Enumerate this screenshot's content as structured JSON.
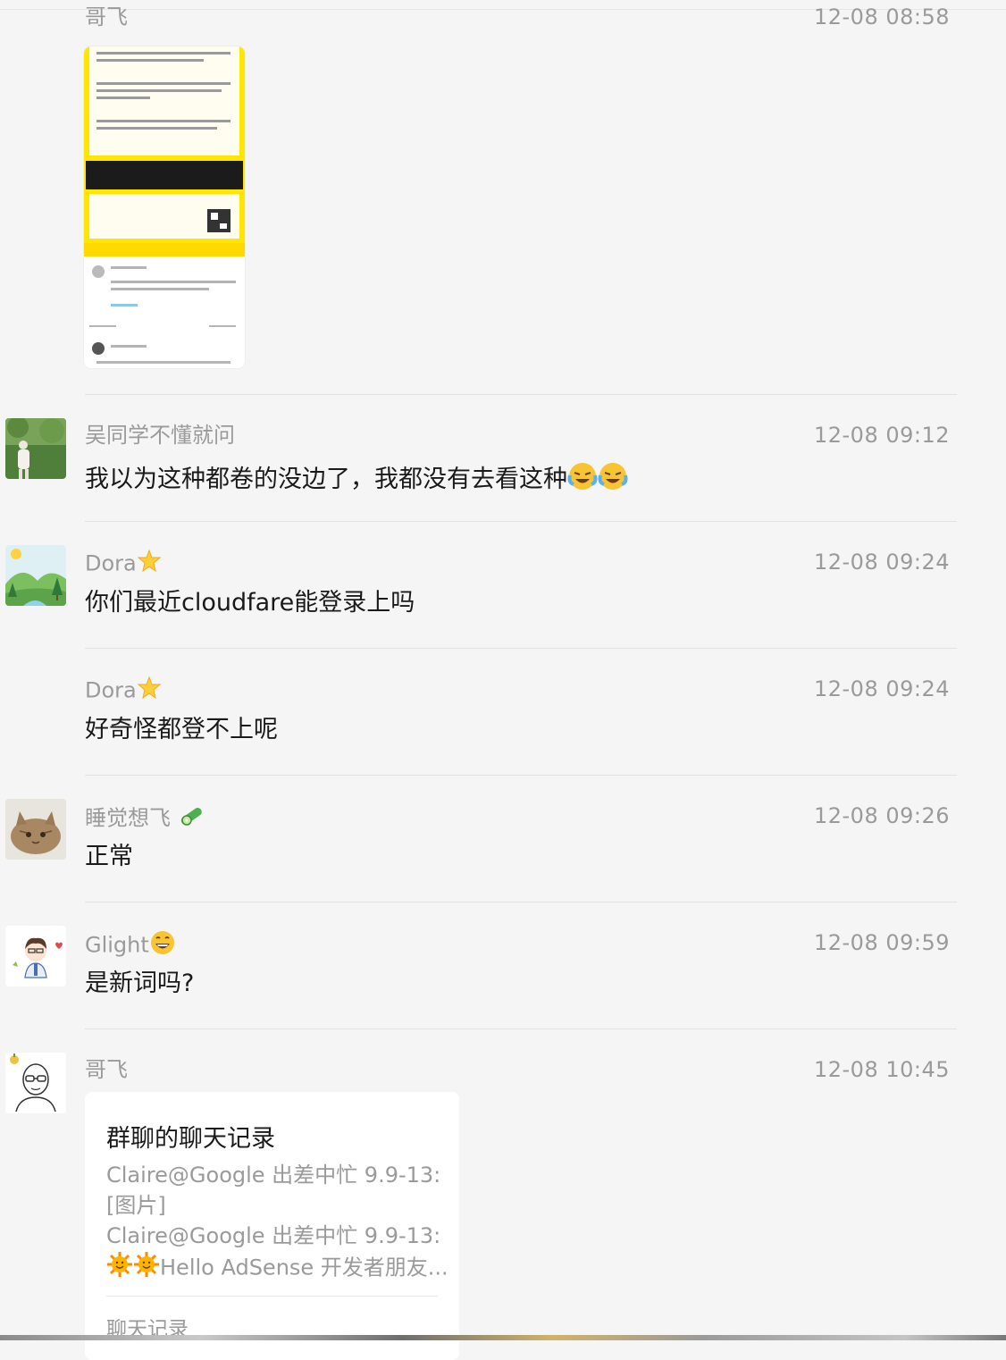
{
  "messages": [
    {
      "sender": "哥飞",
      "time": "12-08 08:58",
      "attachment": "image"
    },
    {
      "sender": "吴同学不懂就问",
      "time": "12-08 09:12",
      "text": "我以为这种都卷的没边了，我都没有去看这种",
      "emojis": [
        "laugh-cry-emoji",
        "laugh-cry-emoji"
      ]
    },
    {
      "sender": "Dora",
      "sender_emoji": "glowing-star-emoji",
      "time": "12-08 09:24",
      "text": "你们最近cloudfare能登录上吗"
    },
    {
      "sender": "Dora",
      "sender_emoji": "glowing-star-emoji",
      "time": "12-08 09:24",
      "text": "好奇怪都登不上呢"
    },
    {
      "sender": "睡觉想飞",
      "sender_emoji": "cucumber-emoji",
      "time": "12-08 09:26",
      "text": "正常"
    },
    {
      "sender": "Glight",
      "sender_emoji": "grinning-emoji",
      "time": "12-08 09:59",
      "text": "是新词吗?"
    },
    {
      "sender": "哥飞",
      "time": "12-08 10:45",
      "attachment": "chat-record"
    }
  ],
  "chat_record": {
    "title": "群聊的聊天记录",
    "lines": [
      "Claire@Google 出差中忙 9.9-13:",
      "[图片]",
      "Claire@Google 出差中忙 9.9-13:",
      "Hello AdSense 开发者朋友..."
    ],
    "line4_emojis": [
      "sun-emoji",
      "sun-emoji"
    ],
    "footer": "聊天记录"
  },
  "colors": {
    "background": "#f5f5f5",
    "sender_text": "#9a9a9a",
    "message_text": "#1a1a1a",
    "card_background": "#ffffff",
    "thumbnail_accent": "#ffe600"
  }
}
